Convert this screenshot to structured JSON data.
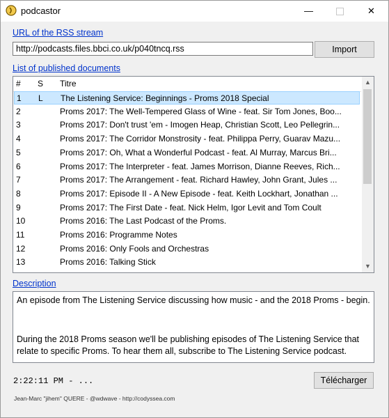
{
  "window": {
    "title": "podcastor",
    "minimize_glyph": "—",
    "close_glyph": "✕"
  },
  "rss": {
    "label": "URL of the RSS stream",
    "url_value": "http://podcasts.files.bbci.co.uk/p040tncq.rss",
    "import_label": "Import"
  },
  "documents": {
    "label": "List of published documents",
    "headers": {
      "num": "#",
      "s": "S",
      "title": "Titre"
    },
    "rows": [
      {
        "num": "1",
        "s": "L",
        "title": "The Listening Service: Beginnings - Proms 2018 Special",
        "selected": true
      },
      {
        "num": "2",
        "s": "",
        "title": "Proms 2017: The Well-Tempered Glass of Wine - feat. Sir Tom Jones, Boo..."
      },
      {
        "num": "3",
        "s": "",
        "title": "Proms 2017: Don't trust 'em - Imogen Heap, Christian Scott, Leo Pellegrin..."
      },
      {
        "num": "4",
        "s": "",
        "title": "Proms 2017: The Corridor Monstrosity - feat. Philippa Perry, Guarav Mazu..."
      },
      {
        "num": "5",
        "s": "",
        "title": "Proms 2017: Oh, What a Wonderful Podcast - feat. Al Murray, Marcus Bri..."
      },
      {
        "num": "6",
        "s": "",
        "title": "Proms 2017: The Interpreter - feat. James Morrison, Dianne Reeves, Rich..."
      },
      {
        "num": "7",
        "s": "",
        "title": "Proms 2017: The Arrangement - feat. Richard Hawley, John Grant, Jules ..."
      },
      {
        "num": "8",
        "s": "",
        "title": "Proms 2017: Episode II - A New Episode - feat. Keith Lockhart, Jonathan ..."
      },
      {
        "num": "9",
        "s": "",
        "title": "Proms 2017: The First Date - feat. Nick Helm, Igor Levit and Tom Coult"
      },
      {
        "num": "10",
        "s": "",
        "title": "Proms 2016: The Last Podcast of the Proms."
      },
      {
        "num": "11",
        "s": "",
        "title": "Proms 2016: Programme Notes"
      },
      {
        "num": "12",
        "s": "",
        "title": "Proms 2016: Only Fools and Orchestras"
      },
      {
        "num": "13",
        "s": "",
        "title": "Proms 2016: Talking Stick"
      }
    ]
  },
  "description": {
    "label": "Description",
    "paragraph1": "An episode from The Listening Service discussing how music - and the 2018 Proms - begin.",
    "paragraph2": "During the 2018 Proms season we'll be publishing episodes of The Listening Service that relate to specific Proms. To hear them all, subscribe to The Listening Service podcast."
  },
  "status": "2:22:11 PM - ...",
  "download_label": "Télécharger",
  "footer": "Jean-Marc \"jihem\" QUERE - @wdwave - http://codyssea.com",
  "colors": {
    "link": "#0033cc",
    "selection": "#cce8ff",
    "selection_border": "#99d1ff"
  }
}
